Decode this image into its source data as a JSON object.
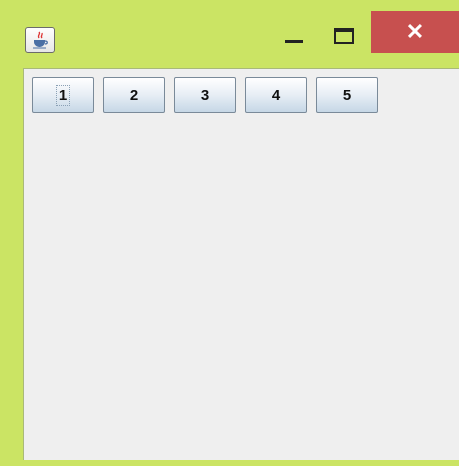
{
  "window": {
    "icon": "java-coffee-icon",
    "controls": {
      "minimize_icon": "minimize-icon",
      "maximize_icon": "maximize-icon",
      "close_icon": "close-icon",
      "close_glyph": "✕"
    },
    "frame_color": "#cbe464",
    "close_color": "#c7504f"
  },
  "buttons": [
    {
      "label": "1",
      "focused": true
    },
    {
      "label": "2"
    },
    {
      "label": "3"
    },
    {
      "label": "4"
    },
    {
      "label": "5"
    }
  ]
}
